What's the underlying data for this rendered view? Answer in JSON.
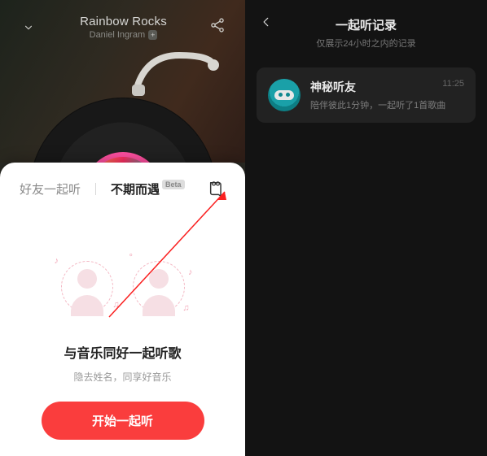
{
  "left": {
    "player": {
      "track_title": "Rainbow Rocks",
      "track_artist": "Daniel Ingram"
    },
    "sheet": {
      "tabs": {
        "friends": "好友一起听",
        "random": "不期而遇",
        "beta_badge": "Beta"
      },
      "title": "与音乐同好一起听歌",
      "subtitle": "隐去姓名，同享好音乐",
      "start_button": "开始一起听",
      "history_icon_name": "history-icon"
    }
  },
  "right": {
    "header": {
      "title": "一起听记录",
      "subtitle": "仅展示24小时之内的记录"
    },
    "card": {
      "avatar_name": "mask-icon",
      "title": "神秘听友",
      "subtitle": "陪伴彼此1分钟，一起听了1首歌曲",
      "time": "11:25"
    }
  }
}
